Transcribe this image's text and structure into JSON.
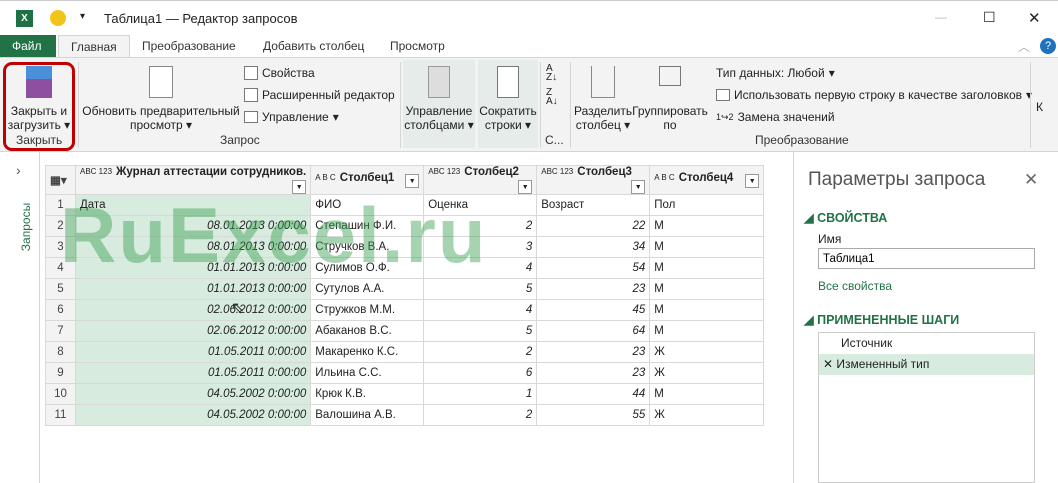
{
  "window": {
    "title": "Таблица1 — Редактор запросов",
    "minimize": "—",
    "maximize": "☐",
    "close": "✕"
  },
  "tabs": [
    {
      "label": "Файл"
    },
    {
      "label": "Главная"
    },
    {
      "label": "Преобразование"
    },
    {
      "label": "Добавить столбец"
    },
    {
      "label": "Просмотр"
    }
  ],
  "ribbon": {
    "close_load": "Закрыть и загрузить",
    "group_close": "Закрыть",
    "refresh": "Обновить предварительный просмотр",
    "properties": "Свойства",
    "advanced_editor": "Расширенный редактор",
    "manage": "Управление",
    "group_query": "Запрос",
    "manage_columns": "Управление столбцами",
    "reduce_rows": "Сократить строки",
    "group_sort": "С...",
    "split_column": "Разделить столбец",
    "group_by": "Группировать по",
    "data_type": "Тип данных: Любой",
    "first_row_headers": "Использовать первую строку в качестве заголовков",
    "replace_values": "Замена значений",
    "group_transform": "Преобразование",
    "overflow": "К"
  },
  "queries_pane": {
    "label": "Запросы"
  },
  "grid": {
    "columns": [
      {
        "type": "ABC 123",
        "name": "Журнал аттестации сотрудников."
      },
      {
        "type": "A B C",
        "name": "Столбец1"
      },
      {
        "type": "ABC 123",
        "name": "Столбец2"
      },
      {
        "type": "ABC 123",
        "name": "Столбец3"
      },
      {
        "type": "A B C",
        "name": "Столбец4"
      }
    ],
    "rows": [
      [
        "1",
        "Дата",
        "ФИО",
        "Оценка",
        "Возраст",
        "Пол"
      ],
      [
        "2",
        "08.01.2013 0:00:00",
        "Степашин Ф.И.",
        "2",
        "22",
        "М"
      ],
      [
        "3",
        "08.01.2013 0:00:00",
        "Стручков В.А.",
        "3",
        "34",
        "М"
      ],
      [
        "4",
        "01.01.2013 0:00:00",
        "Сулимов О.Ф.",
        "4",
        "54",
        "М"
      ],
      [
        "5",
        "01.01.2013 0:00:00",
        "Сутулов А.А.",
        "5",
        "23",
        "М"
      ],
      [
        "6",
        "02.06.2012 0:00:00",
        "Стружков М.М.",
        "4",
        "45",
        "М"
      ],
      [
        "7",
        "02.06.2012 0:00:00",
        "Абаканов В.С.",
        "5",
        "64",
        "М"
      ],
      [
        "8",
        "01.05.2011 0:00:00",
        "Макаренко К.С.",
        "2",
        "23",
        "Ж"
      ],
      [
        "9",
        "01.05.2011 0:00:00",
        "Ильина С.С.",
        "6",
        "23",
        "Ж"
      ],
      [
        "10",
        "04.05.2002 0:00:00",
        "Крюк К.В.",
        "1",
        "44",
        "М"
      ],
      [
        "11",
        "04.05.2002 0:00:00",
        "Валошина А.В.",
        "2",
        "55",
        "Ж"
      ]
    ]
  },
  "watermark": "RuExcel.ru",
  "panel": {
    "title": "Параметры запроса",
    "properties_header": "СВОЙСТВА",
    "name_label": "Имя",
    "name_value": "Таблица1",
    "all_properties": "Все свойства",
    "steps_header": "ПРИМЕНЕННЫЕ ШАГИ",
    "steps": [
      "Источник",
      "Измененный тип"
    ]
  },
  "colors": {
    "accent": "#217346",
    "selected": "#d7ecdf",
    "highlight": "#c00000"
  }
}
